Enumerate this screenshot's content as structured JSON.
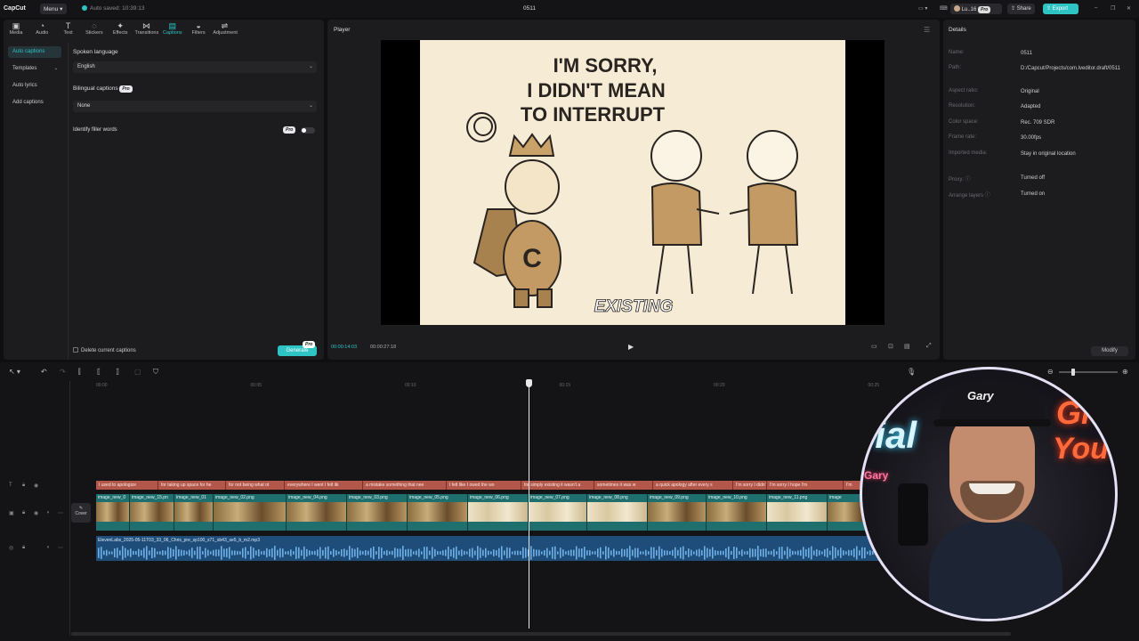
{
  "app": {
    "name": "CapCut",
    "menu_label": "Menu",
    "autosave": "Auto saved: 10:39:13",
    "title": "0511",
    "user": "Lu..16",
    "pro": "Pro",
    "share": "Share",
    "export": "Export"
  },
  "toolbar": {
    "items": [
      {
        "label": "Media",
        "icon": "▣"
      },
      {
        "label": "Audio",
        "icon": "◔"
      },
      {
        "label": "Text",
        "icon": "T"
      },
      {
        "label": "Stickers",
        "icon": "◌"
      },
      {
        "label": "Effects",
        "icon": "✦"
      },
      {
        "label": "Transitions",
        "icon": "⋈"
      },
      {
        "label": "Captions",
        "icon": "▤"
      },
      {
        "label": "Filters",
        "icon": "◒"
      },
      {
        "label": "Adjustment",
        "icon": "⇌"
      }
    ]
  },
  "sidebar": {
    "items": [
      {
        "label": "Auto captions"
      },
      {
        "label": "Templates"
      },
      {
        "label": "Auto lyrics"
      },
      {
        "label": "Add captions"
      }
    ]
  },
  "captions": {
    "spoken_language_label": "Spoken language",
    "spoken_language_value": "English",
    "bilingual_label": "Bilingual captions",
    "bilingual_value": "None",
    "filler_label": "Identify filler words",
    "pro": "Pro",
    "delete_label": "Delete current captions",
    "generate_label": "Generate"
  },
  "player": {
    "title": "Player",
    "subtitle": "EXISTING",
    "current": "00:00:14:03",
    "total": "00:00:27:18",
    "art_text": [
      "I'M SORRY,",
      "I DIDN'T MEAN",
      "TO INTERRUPT"
    ]
  },
  "details": {
    "title": "Details",
    "modify": "Modify",
    "rows": [
      {
        "k": "Name:",
        "v": "0511"
      },
      {
        "k": "Path:",
        "v": "D:/Capcut/Projects/com.lveditor.draft/0511"
      },
      {
        "k": "Aspect ratio:",
        "v": "Original"
      },
      {
        "k": "Resolution:",
        "v": "Adapted"
      },
      {
        "k": "Color space:",
        "v": "Rec. 709 SDR"
      },
      {
        "k": "Frame rate:",
        "v": "30.00fps"
      },
      {
        "k": "Imported media:",
        "v": "Stay in original location"
      },
      {
        "k": "Proxy: ⓘ",
        "v": "Turned off"
      },
      {
        "k": "Arrange layers ⓘ",
        "v": "Turned on"
      }
    ]
  },
  "timeline": {
    "ticks": [
      "00:00",
      "00:05",
      "00:10",
      "00:15",
      "00:20",
      "00:25"
    ],
    "cover_label": "Cover",
    "captions": [
      "I used to apologize",
      "for taking up space for he",
      "for not being what ot",
      "everywhere I went I felt lik",
      "a mistake something that nee",
      "I felt like I owed the wo",
      "for simply existing it wasn't a",
      "sometimes it was w",
      "a quick apology after every s",
      "I'm sorry I didn't m",
      "I'm sorry I hope I'm",
      "I'm"
    ],
    "videos": [
      "image_new_0",
      "image_new_15.pn",
      "image_new_01",
      "image_new_02.png",
      "image_new_04.png",
      "image_new_03.png",
      "image_new_05.png",
      "image_new_06.png",
      "image_new_07.png",
      "image_new_08.png",
      "image_new_09.png",
      "image_new_10.png",
      "image_new_11.png",
      "image"
    ],
    "audio_name": "ElevenLabs_2025-05-11T03_33_06_Chris_pre_sp100_s71_sb43_se5_b_m2.mp3"
  },
  "webcam": {
    "hat_text": "Gary",
    "neon_left": "rial",
    "neon_right_1": "Gr",
    "neon_right_2": "You",
    "neon_small": "Gary"
  },
  "colors": {
    "accent": "#2ec4c4",
    "caption_clip": "#b3574a",
    "video_clip": "#1f6f6f",
    "audio_clip": "#1f4d7a",
    "ring": "#7a6cf0"
  }
}
